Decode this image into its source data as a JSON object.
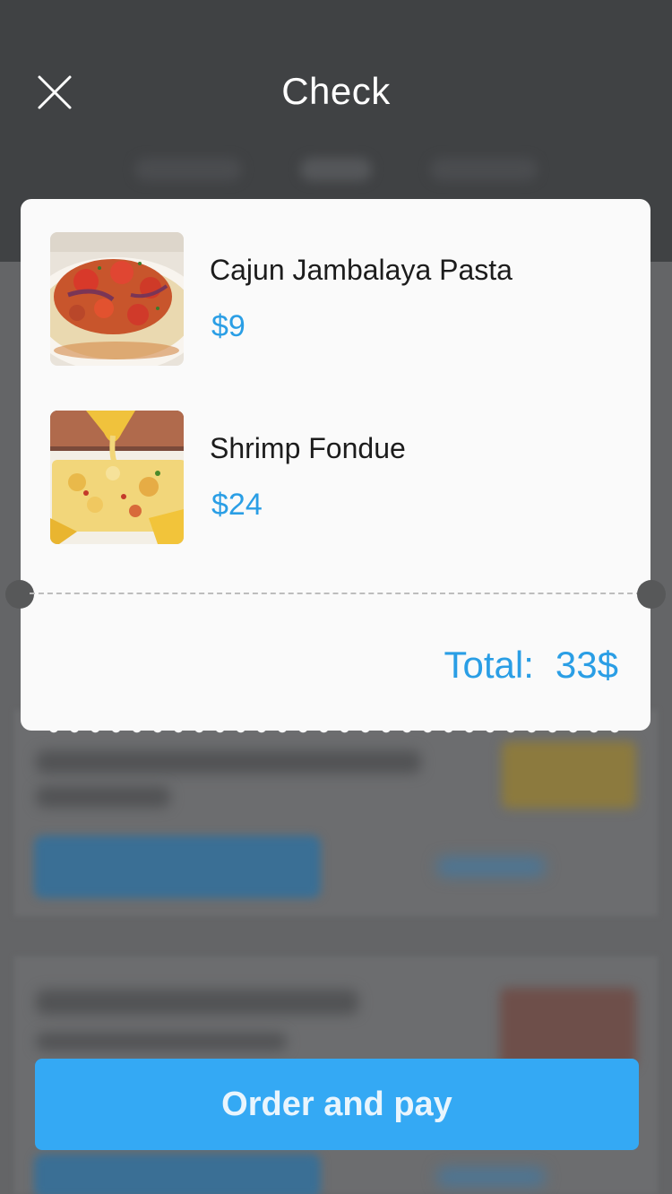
{
  "modal": {
    "title": "Check",
    "close_icon": "close-icon"
  },
  "check": {
    "items": [
      {
        "name": "Cajun Jambalaya Pasta",
        "price": "$9",
        "image": "pasta-photo"
      },
      {
        "name": "Shrimp Fondue",
        "price": "$24",
        "image": "fondue-photo"
      }
    ],
    "total_label": "Total:",
    "total_value": "33$"
  },
  "actions": {
    "order_label": "Order and pay"
  },
  "colors": {
    "accent": "#34a9f4",
    "price": "#2a9ee5",
    "card": "#fafafa",
    "overlay_header": "#404244"
  }
}
